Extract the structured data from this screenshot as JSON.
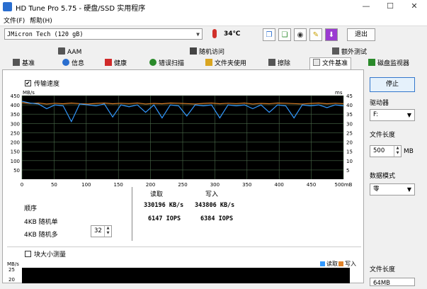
{
  "window": {
    "title": "HD Tune Pro 5.75 - 硬盘/SSD 实用程序",
    "minimize": "—",
    "maximize": "☐",
    "close": "✕"
  },
  "menu": [
    "文件(F)",
    "帮助(H)"
  ],
  "toolbar": {
    "drive": "JMicron Tech (120 gB)",
    "temperature": "34℃",
    "exit_label": "退出",
    "buttons": [
      "copy-icon",
      "copy-all-icon",
      "camera-icon",
      "star-icon",
      "download-icon"
    ]
  },
  "tabs_top": [
    "AAM",
    "随机访问",
    "额外测试"
  ],
  "tabs_bottom": [
    "基准",
    "信息",
    "健康",
    "错误扫描",
    "文件夹使用",
    "擦除",
    "文件基准",
    "磁盘监视器"
  ],
  "active_tab": "文件基准",
  "transfer": {
    "checkbox_label": "传输速度",
    "checked": true,
    "unit_left": "MB/s",
    "unit_right": "ms",
    "y_left": [
      "450",
      "400",
      "350",
      "300",
      "250",
      "200",
      "150",
      "100",
      "50"
    ],
    "y_right": [
      "45",
      "40",
      "35",
      "30",
      "25",
      "20",
      "15",
      "10",
      "5"
    ],
    "x_ticks": [
      "0",
      "50",
      "100",
      "150",
      "200",
      "250",
      "300",
      "350",
      "400",
      "450",
      "500mB"
    ]
  },
  "results": {
    "read_header": "读取",
    "write_header": "写入",
    "rows": [
      {
        "label": "顺序",
        "read": "330196 KB/s",
        "write": "343806 KB/s"
      },
      {
        "label": "4KB 随机单",
        "read": "6147 IOPS",
        "write": "6384 IOPS"
      },
      {
        "label": "4KB 随机多",
        "read": "",
        "write": "",
        "queue": "32"
      }
    ]
  },
  "blocksize": {
    "checkbox_label": "块大小测量",
    "checked": false,
    "unit": "MB/s",
    "y_top": "25",
    "y_next": "20",
    "legend": [
      "读取",
      "写入"
    ]
  },
  "right_panel": {
    "stop_label": "停止",
    "drive_label": "驱动器",
    "drive_value": "F:",
    "filesize_label": "文件长度",
    "filesize_value": "500",
    "filesize_unit": "MB",
    "pattern_label": "数据模式",
    "pattern_value": "零",
    "filesize2_label": "文件长度",
    "filesize2_value": "64MB"
  },
  "chart_data": {
    "type": "line",
    "xlabel": "",
    "ylabel": "",
    "xlim": [
      0,
      500
    ],
    "ylim_left": [
      0,
      450
    ],
    "ylim_right": [
      0,
      45
    ],
    "series": [
      {
        "color": "#3399ff",
        "values": [
          420,
          410,
          405,
          380,
          400,
          395,
          310,
          405,
          400,
          395,
          405,
          335,
          400,
          390,
          400,
          360,
          400,
          330,
          400,
          395,
          340,
          400,
          395,
          400,
          330,
          400,
          395,
          400,
          380,
          400,
          360,
          400,
          395,
          330,
          400,
          395,
          400,
          385,
          400,
          395
        ]
      },
      {
        "color": "#e0832a",
        "values": [
          412,
          408,
          410,
          405,
          409,
          406,
          410,
          407,
          405,
          408,
          410,
          406,
          409,
          407,
          410,
          405,
          408,
          406,
          410,
          409,
          407,
          405,
          408,
          410,
          406,
          409,
          407,
          410,
          405,
          408,
          406,
          410,
          409,
          407,
          405,
          408,
          410,
          406,
          409,
          407
        ]
      }
    ],
    "colors": {
      "read": "#3399ff",
      "write": "#e0832a",
      "grid": "#4a6a4a",
      "background": "#000000"
    }
  }
}
